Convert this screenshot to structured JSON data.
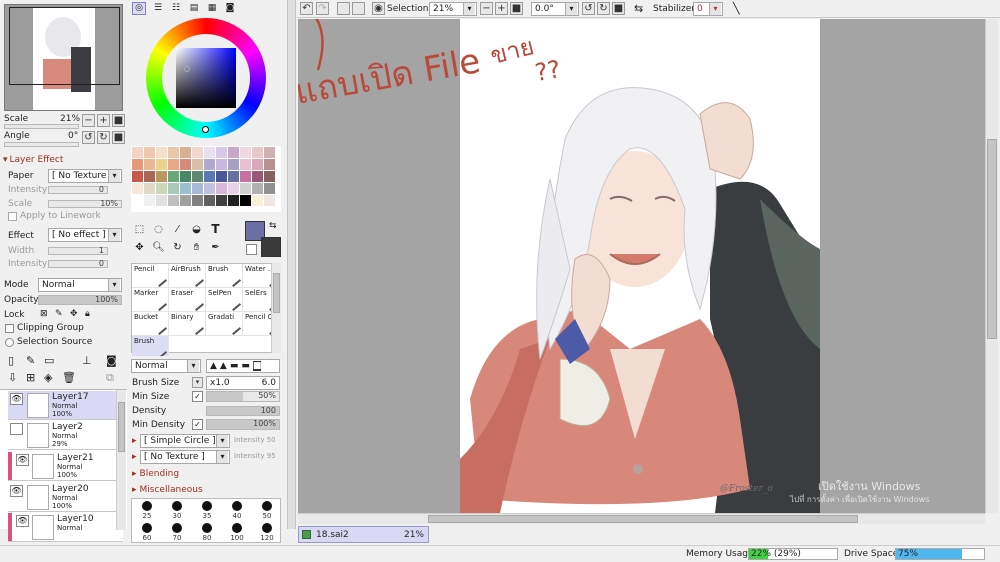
{
  "navigator": {
    "scale_label": "Scale",
    "scale_value": "21%",
    "angle_label": "Angle",
    "angle_value": "0°"
  },
  "layer_effect": {
    "header": "Layer Effect",
    "paper_label": "Paper",
    "paper_value": "[ No Texture ]",
    "intensity_label": "Intensity",
    "intensity_value": "0",
    "scale_label": "Scale",
    "scale_value": "10%",
    "apply_linework": "Apply to Linework",
    "effect_label": "Effect",
    "effect_value": "[ No effect ]",
    "width_label": "Width",
    "width_value": "1",
    "intensity2_label": "Intensity",
    "intensity2_value": "0"
  },
  "layer_props": {
    "mode_label": "Mode",
    "mode_value": "Normal",
    "opacity_label": "Opacity",
    "opacity_value": "100%",
    "lock_label": "Lock",
    "clipping_group": "Clipping Group",
    "selection_source": "Selection Source"
  },
  "layers": [
    {
      "name": "Layer17",
      "mode": "Normal",
      "opacity": "100%"
    },
    {
      "name": "Layer2",
      "mode": "Normal",
      "opacity": "29%"
    },
    {
      "name": "Layer21",
      "mode": "Normal",
      "opacity": "100%"
    },
    {
      "name": "Layer20",
      "mode": "Normal",
      "opacity": "100%"
    },
    {
      "name": "Layer10",
      "mode": "Normal",
      "opacity": ""
    }
  ],
  "tools": [
    {
      "label": "Pencil"
    },
    {
      "label": "AirBrush"
    },
    {
      "label": "Brush"
    },
    {
      "label": "Water ..."
    },
    {
      "label": "Marker"
    },
    {
      "label": "Eraser"
    },
    {
      "label": "SelPen"
    },
    {
      "label": "SelErs"
    },
    {
      "label": "Bucket"
    },
    {
      "label": "Binary"
    },
    {
      "label": "Gradati"
    },
    {
      "label": "Pencil O"
    },
    {
      "label": "Brush"
    }
  ],
  "brush_settings": {
    "blend_value": "Normal",
    "brush_size_label": "Brush Size",
    "brush_size_mult": "x1.0",
    "brush_size_value": "6.0",
    "min_size_label": "Min Size",
    "min_size_value": "50%",
    "density_label": "Density",
    "density_value": "100",
    "min_density_label": "Min Density",
    "min_density_value": "100%",
    "shape_value": "[ Simple Circle ]",
    "shape_intensity": "Intensity 50",
    "texture_value": "[ No Texture ]",
    "texture_intensity": "Intensity 95",
    "blending_header": "Blending",
    "misc_header": "Miscellaneous"
  },
  "brush_sizes": [
    "25",
    "30",
    "35",
    "40",
    "50",
    "60",
    "70",
    "80",
    "100",
    "120"
  ],
  "toolbar": {
    "selection_label": "Selection",
    "zoom_value": "21%",
    "angle_value": "0.0°",
    "stabilizer_label": "Stabilizer",
    "stabilizer_value": "0"
  },
  "canvas": {
    "handwriting_open": "แถบเปิด File",
    "handwriting_sell": "ขาย",
    "handwriting_q": "??",
    "signature": "@Froster_o",
    "watermark_line1": "เปิดใช้งาน Windows",
    "watermark_line2": "ไปที่ การตั้งค่า เพื่อเปิดใช้งาน Windows"
  },
  "status": {
    "file_name": "18.sai2",
    "file_zoom": "21%",
    "memory_label": "Memory Usage",
    "memory_value": "22% (29%)",
    "memory_pct": 22,
    "drive_label": "Drive Space",
    "drive_value": "75%",
    "drive_pct": 75
  },
  "colors": {
    "accent": "#7f7fc8",
    "current_color": "#6b6fa4",
    "handwriting": "#b94a3a",
    "usage_fill": "#3fd43f",
    "drive_fill": "#4fb7f0"
  },
  "swatch_colors": [
    "#f4d4c4",
    "#f0c8b0",
    "#f4e0c8",
    "#e8c8a8",
    "#d8b090",
    "#f0d8d0",
    "#e8e0f0",
    "#d8c8e8",
    "#c8a8c8",
    "#f0d8e0",
    "#e8c8c8",
    "#d0b0b0",
    "#e89878",
    "#e8b890",
    "#f0d090",
    "#e8a888",
    "#d88878",
    "#d8c0a8",
    "#b0a8d0",
    "#c8b8e0",
    "#a8a0c0",
    "#e8c0d0",
    "#d8a8b8",
    "#b89090",
    "#c85848",
    "#a86858",
    "#b89860",
    "#68a878",
    "#488868",
    "#608870",
    "#5878b8",
    "#485898",
    "#6870a0",
    "#c870a0",
    "#985878",
    "#886060",
    "#f8e8d8",
    "#e0d8c8",
    "#c8d8b8",
    "#a8c8b8",
    "#98c0d0",
    "#a8b8d8",
    "#c0c0e0",
    "#d8b8d8",
    "#e8d0e8",
    "#d0d0d0",
    "#b0b0b0",
    "#909090",
    "#ffffff",
    "#f0f0f0",
    "#e0e0e0",
    "#c0c0c0",
    "#a0a0a0",
    "#808080",
    "#606060",
    "#404040",
    "#202020",
    "#000000",
    "#f8f0d8",
    "#f0e8e0"
  ]
}
